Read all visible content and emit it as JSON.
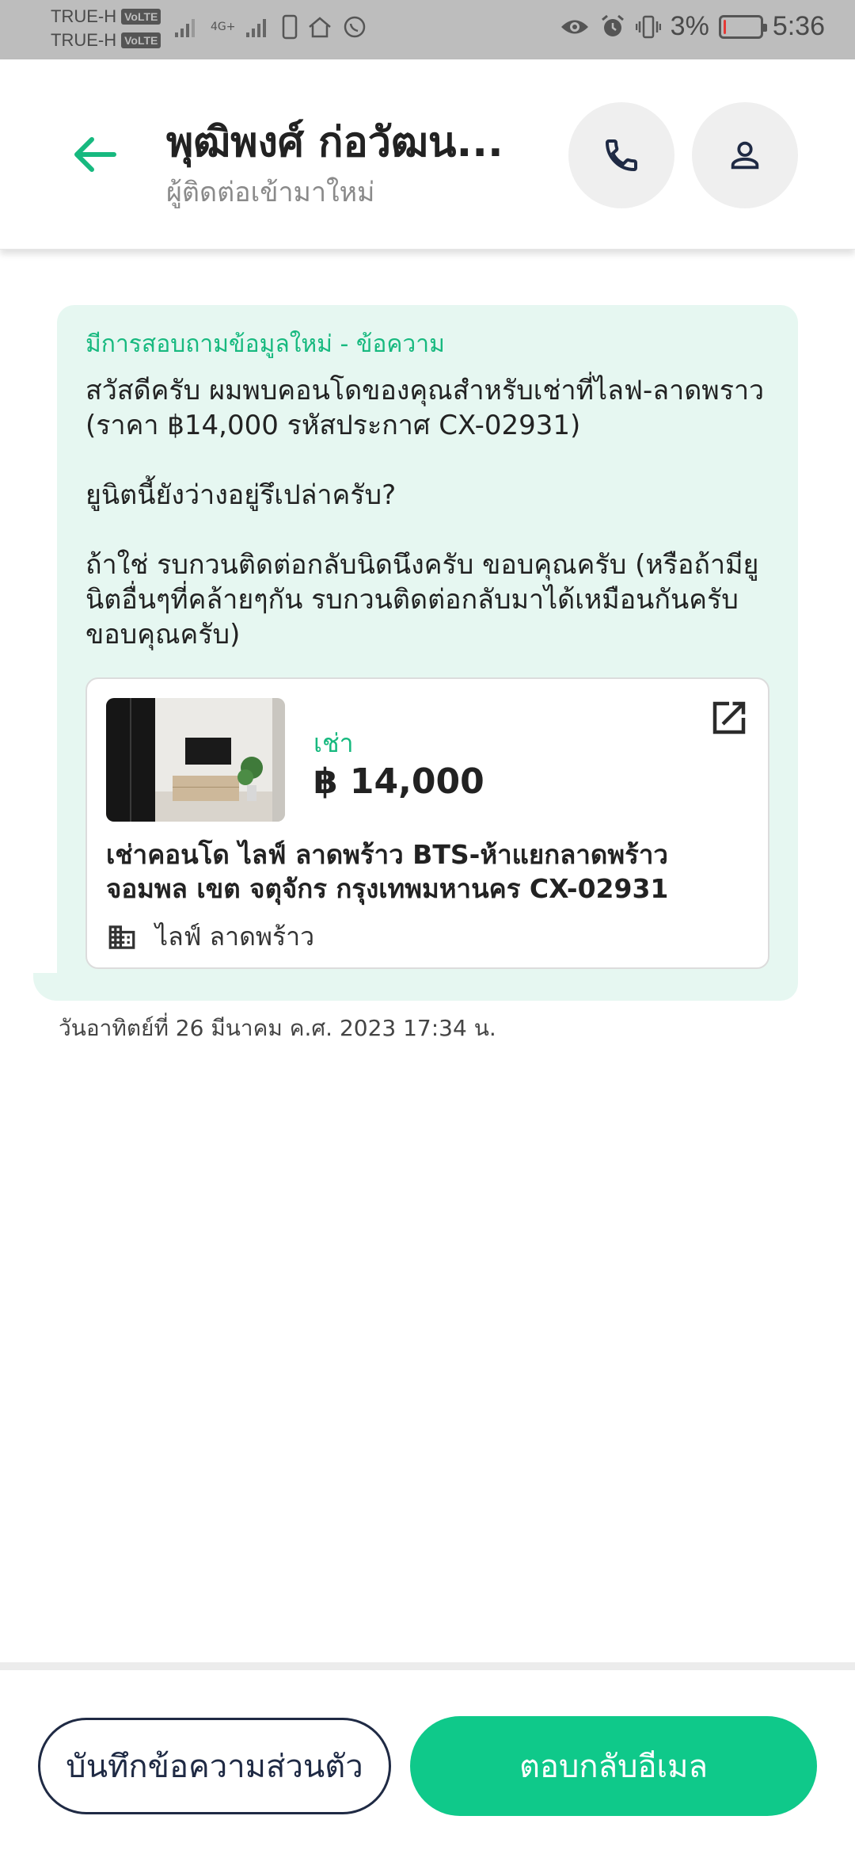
{
  "status_bar": {
    "carrier_1": "TRUE-H",
    "carrier_2": "TRUE-H",
    "volte_badge": "VoLTE",
    "network_label": "4G+",
    "battery_percent": "3%",
    "time": "5:36",
    "battery_level": 0.03,
    "battery_color": "#e53935"
  },
  "header": {
    "contact_name": "พุฒิพงศ์ ก่อวัฒน...",
    "contact_subtitle": "ผู้ติดต่อเข้ามาใหม่",
    "accent_color": "#17b97f"
  },
  "message": {
    "heading": "มีการสอบถามข้อมูลใหม่ - ข้อความ",
    "paragraphs": [
      "สวัสดีครับ ผมพบคอนโดของคุณสำหรับเช่าที่ไลฟ-ลาดพราว (ราคา ฿14,000 รหัสประกาศ CX-02931)",
      "ยูนิตนี้ยังว่างอยู่รึเปล่าครับ?",
      "ถ้าใช่ รบกวนติดต่อกลับนิดนึงครับ ขอบคุณครับ (หรือถ้ามียูนิตอื่นๆที่คล้ายๆกัน รบกวนติดต่อกลับมาได้เหมือนกันครับ ขอบคุณครับ)"
    ],
    "bubble_color": "#e6f7f1",
    "timestamp": "วันอาทิตย์ที่ 26 มีนาคม ค.ศ. 2023 17:34 น."
  },
  "listing": {
    "type_label": "เช่า",
    "price": "฿ 14,000",
    "title": "เช่าคอนโด ไลฟ์ ลาดพร้าว BTS-ห้าแยกลาดพร้าว จอมพล  เขต จตุจักร กรุงเทพมหานคร CX-02931",
    "project_name": "ไลฟ์ ลาดพร้าว",
    "icons": {
      "open": "open-external-icon",
      "building": "building-icon"
    }
  },
  "actions": {
    "note_button": "บันทึกข้อความส่วนตัว",
    "reply_button": "ตอบกลับอีเมล",
    "reply_color": "#0fc98a"
  }
}
